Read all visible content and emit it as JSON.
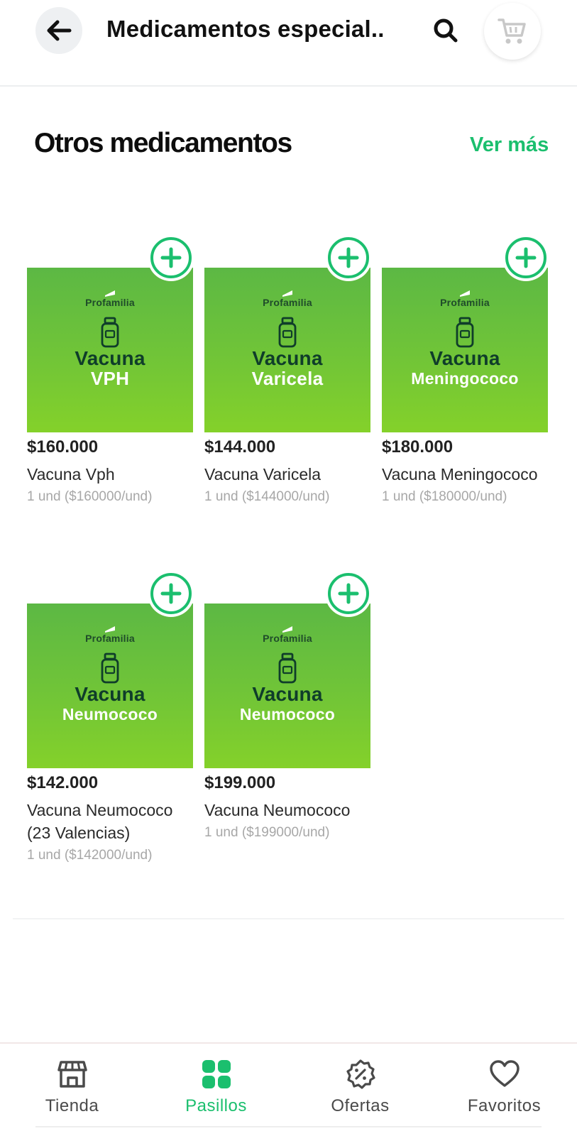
{
  "header": {
    "title": "Medicamentos especial..",
    "back_icon": "arrow-left-icon",
    "search_icon": "search-icon",
    "cart_icon": "shopping-cart-icon"
  },
  "section": {
    "title": "Otros medicamentos",
    "see_more": "Ver más"
  },
  "products": [
    {
      "image": {
        "brand": "Profamilia",
        "title": "Vacuna",
        "subtitle": "VPH"
      },
      "price": "$160.000",
      "name": "Vacuna Vph",
      "unit": "1 und ($160000/und)"
    },
    {
      "image": {
        "brand": "Profamilia",
        "title": "Vacuna",
        "subtitle": "Varicela"
      },
      "price": "$144.000",
      "name": "Vacuna Varicela",
      "unit": "1 und ($144000/und)"
    },
    {
      "image": {
        "brand": "Profamilia",
        "title": "Vacuna",
        "subtitle": "Meningococo"
      },
      "price": "$180.000",
      "name": "Vacuna Meningococo",
      "unit": "1 und ($180000/und)"
    },
    {
      "image": {
        "brand": "Profamilia",
        "title": "Vacuna",
        "subtitle": "Neumococo"
      },
      "price": "$142.000",
      "name": "Vacuna Neumococo (23 Valencias)",
      "unit": "1 und ($142000/und)"
    },
    {
      "image": {
        "brand": "Profamilia",
        "title": "Vacuna",
        "subtitle": "Neumococo"
      },
      "price": "$199.000",
      "name": "Vacuna Neumococo",
      "unit": "1 und ($199000/und)"
    }
  ],
  "bottom_nav": [
    {
      "label": "Tienda",
      "icon": "store-icon",
      "active": false
    },
    {
      "label": "Pasillos",
      "icon": "grid-icon",
      "active": true
    },
    {
      "label": "Ofertas",
      "icon": "discount-badge-icon",
      "active": false
    },
    {
      "label": "Favoritos",
      "icon": "heart-icon",
      "active": false
    }
  ],
  "colors": {
    "accent": "#1bbf6e",
    "product_bg_top": "#5cb844",
    "product_bg_bottom": "#84d12a",
    "product_title": "#0f3d2a"
  }
}
